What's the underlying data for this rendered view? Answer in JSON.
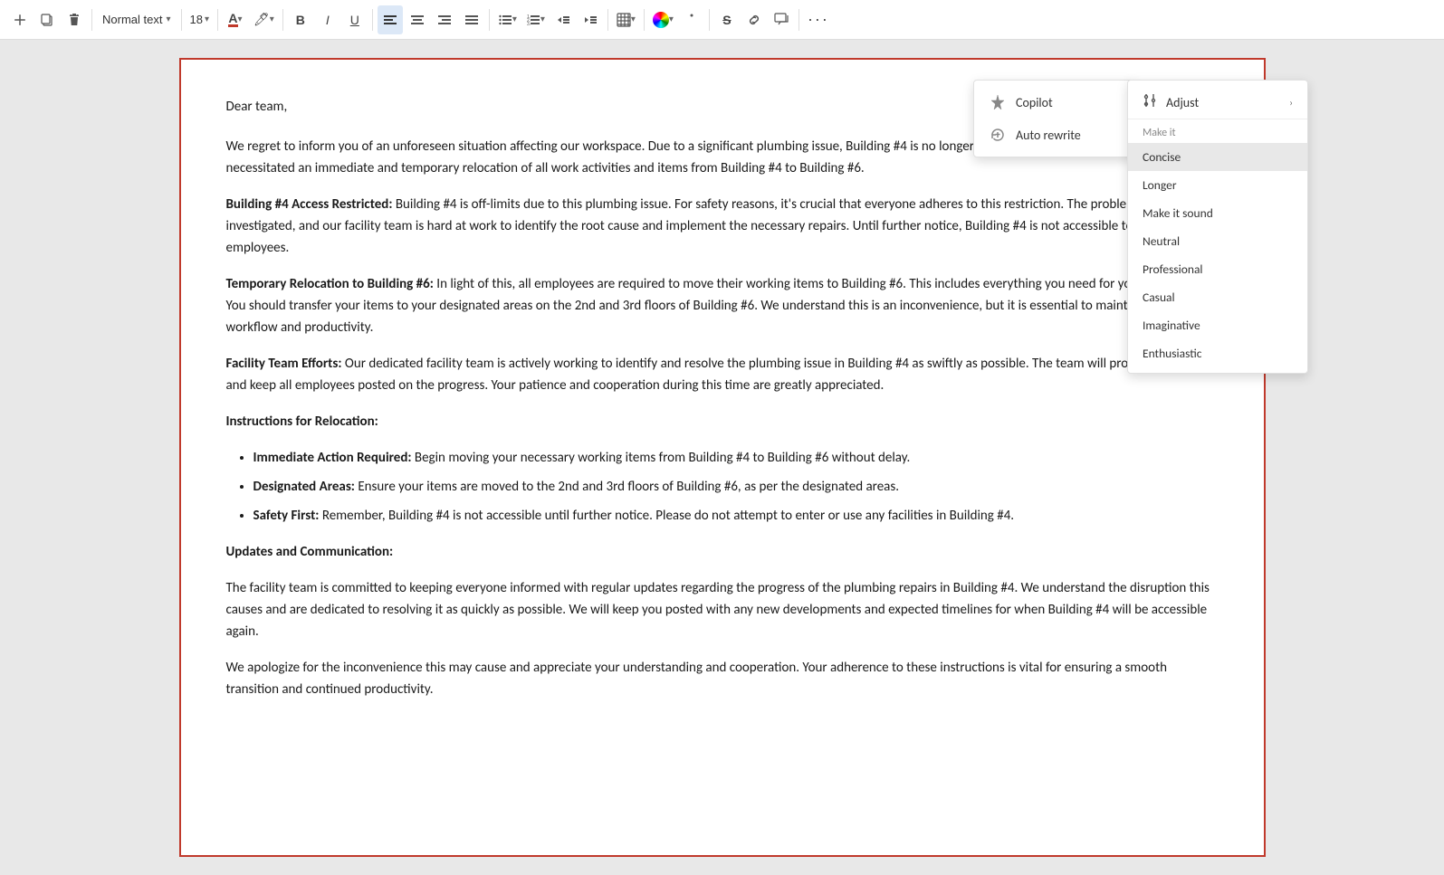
{
  "toolbar": {
    "style_label": "Normal text",
    "font_size": "18",
    "bold_label": "B",
    "italic_label": "I",
    "underline_label": "U"
  },
  "copilot_menu": {
    "items": [
      {
        "id": "copilot",
        "label": "Copilot",
        "icon": "copilot"
      },
      {
        "id": "auto-rewrite",
        "label": "Auto rewrite",
        "icon": "rewrite"
      }
    ]
  },
  "adjust_menu": {
    "header": "Adjust",
    "make_it_label": "Make it",
    "items": [
      {
        "id": "concise",
        "label": "Concise",
        "selected": true
      },
      {
        "id": "longer",
        "label": "Longer",
        "selected": false
      },
      {
        "id": "make-sound",
        "label": "Make it sound",
        "selected": false
      },
      {
        "id": "neutral",
        "label": "Neutral",
        "selected": false
      },
      {
        "id": "professional",
        "label": "Professional",
        "selected": false
      },
      {
        "id": "casual",
        "label": "Casual",
        "selected": false
      },
      {
        "id": "imaginative",
        "label": "Imaginative",
        "selected": false
      },
      {
        "id": "enthusiastic",
        "label": "Enthusiastic",
        "selected": false
      }
    ]
  },
  "document": {
    "greeting": "Dear team,",
    "intro": "We regret to inform you of an unforeseen situation affecting our workspace. Due to a significant plumbing issue, Building #4 is no longer accessible. This unforeseen problem has necessitated an immediate and temporary relocation of all work activities and items from Building #4 to Building #6.",
    "section1_title": "Building #4 Access Restricted:",
    "section1_body": " Building #4 is off-limits due to this plumbing issue. For safety reasons, it's crucial that everyone adheres to this restriction. The problem is being investigated, and our facility team is hard at work to identify the root cause and implement the necessary repairs. Until further notice, Building #4 is not accessible to any employees.",
    "section2_title": "Temporary Relocation to Building #6:",
    "section2_body": " In light of this, all employees are required to move their working items to Building #6. This includes everything you need for your daily tasks. You should transfer your items to your designated areas on the 2nd and 3rd floors of Building #6. We understand this is an inconvenience, but it is essential to maintain our workflow and productivity.",
    "section3_title": "Facility Team Efforts:",
    "section3_body": " Our dedicated facility team is actively working to identify and resolve the plumbing issue in Building #4 as swiftly as possible. The team will provide updates and keep all employees posted on the progress. Your patience and cooperation during this time are greatly appreciated.",
    "section4_title": "Instructions for Relocation:",
    "bullet1_title": "Immediate Action Required:",
    "bullet1_body": " Begin moving your necessary working items from Building #4 to Building #6 without delay.",
    "bullet2_title": "Designated Areas:",
    "bullet2_body": " Ensure your items are moved to the 2nd and 3rd floors of Building #6, as per the designated areas.",
    "bullet3_title": "Safety First:",
    "bullet3_body": " Remember, Building #4 is not accessible until further notice. Please do not attempt to enter or use any facilities in Building #4.",
    "section5_title": "Updates and Communication:",
    "section5_body": "The facility team is committed to keeping everyone informed with regular updates regarding the progress of the plumbing repairs in Building #4. We understand the disruption this causes and are dedicated to resolving it as quickly as possible. We will keep you posted with any new developments and expected timelines for when Building #4 will be accessible again.",
    "closing": "We apologize for the inconvenience this may cause and appreciate your understanding and cooperation. Your adherence to these instructions is vital for ensuring a smooth transition and continued productivity."
  }
}
